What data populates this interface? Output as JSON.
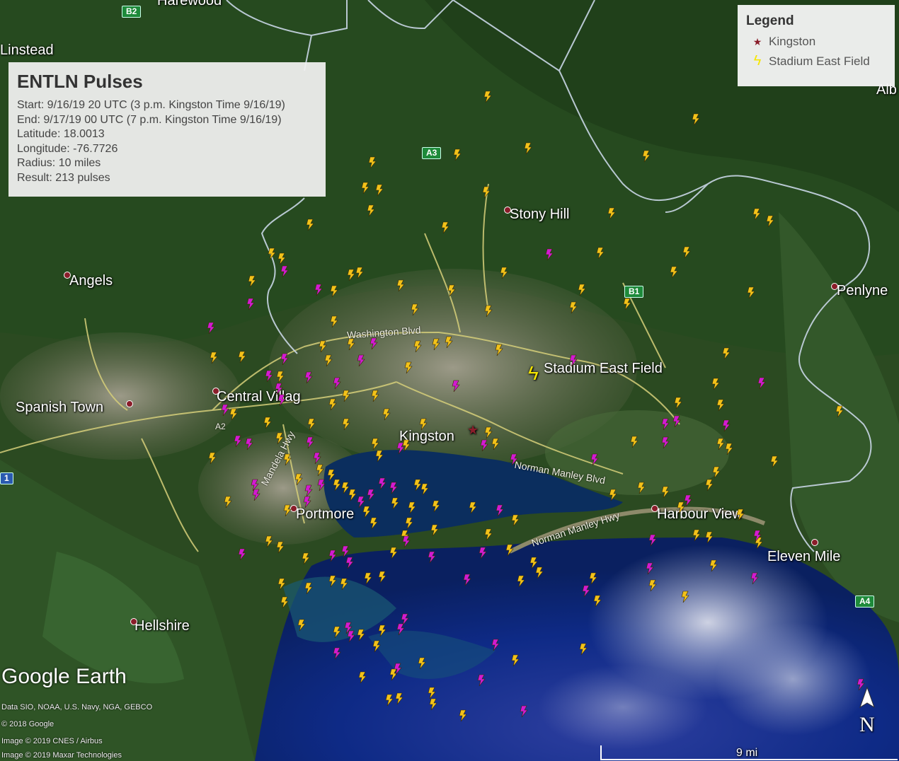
{
  "info_box": {
    "title": "ENTLN Pulses",
    "start": "Start: 9/16/19 20 UTC (3 p.m. Kingston Time 9/16/19)",
    "end": "End: 9/17/19 00 UTC (7 p.m. Kingston Time 9/16/19)",
    "latitude": "Latitude: 18.0013",
    "longitude": "Longitude: -76.7726",
    "radius": "Radius: 10 miles",
    "result": "Result: 213 pulses"
  },
  "legend": {
    "title": "Legend",
    "items": [
      {
        "label": "Kingston",
        "icon": "star-marker-icon",
        "color": "#8a1d2a"
      },
      {
        "label": "Stadium East Field",
        "icon": "lightning-cluster-icon",
        "color": "#f5e600"
      }
    ]
  },
  "places": {
    "harewood": "Harewood",
    "linstead": "Linstead",
    "angels": "Angels",
    "stony_hill": "Stony Hill",
    "penlyne": "Penlyne",
    "spanish_town": "Spanish Town",
    "central_village": "Central Villag",
    "kingston": "Kingston",
    "portmore": "Portmore",
    "harbour_view": "Harbour View",
    "eleven_mile": "Eleven Mile",
    "hellshire": "Hellshire",
    "stadium_east_field": "Stadium East Field",
    "alb": "Alb"
  },
  "roads": {
    "washington_blvd": "Washington Blvd",
    "norman_manley_blvd": "Norman Manley Blvd",
    "norman_manley_hwy": "Norman Manley Hwy",
    "nelson_mandela": "Mandela Hwy"
  },
  "shields": {
    "b2": "B2",
    "a3": "A3",
    "b1": "B1",
    "a4": "A4",
    "a1": "1",
    "a2": "A2"
  },
  "attribution": {
    "logo": "Google Earth",
    "line1": "Data SIO, NOAA, U.S. Navy, NGA, GEBCO",
    "line2": "© 2018 Google",
    "line3": "Image © 2019 CNES / Airbus",
    "line4": "Image © 2019 Maxar Technologies"
  },
  "scale_label": "9 mi",
  "north_label": "N",
  "colors": {
    "pulse_yellow": "#f2c21a",
    "pulse_magenta": "#d21ad2",
    "boundary": "#c9d6e6",
    "road": "#d9d37a",
    "water": "#0d2a7a"
  },
  "pulses": {
    "yellow": [
      [
        689,
        137
      ],
      [
        983,
        169
      ],
      [
        746,
        210
      ],
      [
        646,
        219
      ],
      [
        913,
        221
      ],
      [
        526,
        230
      ],
      [
        516,
        266
      ],
      [
        536,
        269
      ],
      [
        687,
        272
      ],
      [
        524,
        298
      ],
      [
        864,
        302
      ],
      [
        1069,
        303
      ],
      [
        1088,
        313
      ],
      [
        438,
        318
      ],
      [
        629,
        322
      ],
      [
        384,
        359
      ],
      [
        970,
        357
      ],
      [
        848,
        358
      ],
      [
        398,
        366
      ],
      [
        952,
        385
      ],
      [
        496,
        389
      ],
      [
        508,
        386
      ],
      [
        712,
        386
      ],
      [
        472,
        412
      ],
      [
        566,
        404
      ],
      [
        356,
        398
      ],
      [
        638,
        411
      ],
      [
        822,
        410
      ],
      [
        1061,
        414
      ],
      [
        586,
        438
      ],
      [
        690,
        440
      ],
      [
        810,
        435
      ],
      [
        886,
        430
      ],
      [
        472,
        455
      ],
      [
        302,
        506
      ],
      [
        456,
        490
      ],
      [
        496,
        487
      ],
      [
        590,
        490
      ],
      [
        616,
        487
      ],
      [
        634,
        484
      ],
      [
        705,
        495
      ],
      [
        342,
        505
      ],
      [
        464,
        510
      ],
      [
        577,
        520
      ],
      [
        1026,
        500
      ],
      [
        1011,
        543
      ],
      [
        958,
        570
      ],
      [
        1018,
        573
      ],
      [
        1186,
        582
      ],
      [
        489,
        560
      ],
      [
        530,
        560
      ],
      [
        546,
        586
      ],
      [
        489,
        600
      ],
      [
        396,
        533
      ],
      [
        470,
        572
      ],
      [
        330,
        586
      ],
      [
        378,
        598
      ],
      [
        440,
        600
      ],
      [
        395,
        620
      ],
      [
        300,
        648
      ],
      [
        406,
        650
      ],
      [
        422,
        678
      ],
      [
        488,
        690
      ],
      [
        530,
        628
      ],
      [
        536,
        645
      ],
      [
        574,
        630
      ],
      [
        598,
        600
      ],
      [
        690,
        612
      ],
      [
        700,
        628
      ],
      [
        896,
        625
      ],
      [
        1018,
        628
      ],
      [
        1030,
        635
      ],
      [
        1094,
        653
      ],
      [
        1012,
        668
      ],
      [
        1002,
        686
      ],
      [
        452,
        665
      ],
      [
        468,
        672
      ],
      [
        476,
        686
      ],
      [
        498,
        700
      ],
      [
        556,
        690
      ],
      [
        590,
        686
      ],
      [
        600,
        692
      ],
      [
        616,
        716
      ],
      [
        322,
        710
      ],
      [
        406,
        722
      ],
      [
        518,
        724
      ],
      [
        528,
        740
      ],
      [
        558,
        712
      ],
      [
        582,
        718
      ],
      [
        578,
        740
      ],
      [
        572,
        758
      ],
      [
        614,
        750
      ],
      [
        668,
        718
      ],
      [
        690,
        756
      ],
      [
        728,
        736
      ],
      [
        720,
        778
      ],
      [
        380,
        766
      ],
      [
        396,
        774
      ],
      [
        432,
        790
      ],
      [
        398,
        826
      ],
      [
        436,
        832
      ],
      [
        470,
        822
      ],
      [
        486,
        826
      ],
      [
        520,
        818
      ],
      [
        540,
        816
      ],
      [
        556,
        782
      ],
      [
        754,
        796
      ],
      [
        762,
        810
      ],
      [
        736,
        822
      ],
      [
        866,
        700
      ],
      [
        906,
        690
      ],
      [
        940,
        696
      ],
      [
        962,
        718
      ],
      [
        1046,
        728
      ],
      [
        1002,
        760
      ],
      [
        984,
        757
      ],
      [
        1008,
        800
      ],
      [
        1072,
        768
      ],
      [
        838,
        818
      ],
      [
        844,
        850
      ],
      [
        922,
        828
      ],
      [
        968,
        844
      ],
      [
        402,
        852
      ],
      [
        426,
        884
      ],
      [
        476,
        894
      ],
      [
        510,
        898
      ],
      [
        540,
        892
      ],
      [
        532,
        914
      ],
      [
        596,
        938
      ],
      [
        824,
        918
      ],
      [
        728,
        934
      ],
      [
        512,
        958
      ],
      [
        556,
        954
      ],
      [
        550,
        990
      ],
      [
        564,
        988
      ],
      [
        610,
        980
      ],
      [
        612,
        996
      ],
      [
        654,
        1012
      ]
    ],
    "magenta": [
      [
        776,
        360
      ],
      [
        402,
        384
      ],
      [
        450,
        410
      ],
      [
        354,
        430
      ],
      [
        298,
        464
      ],
      [
        528,
        486
      ],
      [
        510,
        510
      ],
      [
        402,
        508
      ],
      [
        380,
        532
      ],
      [
        436,
        534
      ],
      [
        644,
        546
      ],
      [
        476,
        542
      ],
      [
        394,
        550
      ],
      [
        398,
        566
      ],
      [
        318,
        580
      ],
      [
        810,
        510
      ],
      [
        1076,
        542
      ],
      [
        940,
        600
      ],
      [
        956,
        596
      ],
      [
        1026,
        602
      ],
      [
        940,
        626
      ],
      [
        336,
        624
      ],
      [
        352,
        628
      ],
      [
        438,
        626
      ],
      [
        448,
        648
      ],
      [
        566,
        634
      ],
      [
        684,
        630
      ],
      [
        726,
        650
      ],
      [
        840,
        650
      ],
      [
        360,
        686
      ],
      [
        362,
        700
      ],
      [
        436,
        694
      ],
      [
        434,
        710
      ],
      [
        454,
        686
      ],
      [
        510,
        710
      ],
      [
        524,
        700
      ],
      [
        540,
        684
      ],
      [
        556,
        690
      ],
      [
        706,
        722
      ],
      [
        972,
        708
      ],
      [
        574,
        766
      ],
      [
        610,
        788
      ],
      [
        660,
        820
      ],
      [
        682,
        782
      ],
      [
        488,
        780
      ],
      [
        494,
        796
      ],
      [
        470,
        786
      ],
      [
        342,
        784
      ],
      [
        922,
        764
      ],
      [
        918,
        804
      ],
      [
        828,
        836
      ],
      [
        1070,
        758
      ],
      [
        1066,
        818
      ],
      [
        572,
        876
      ],
      [
        566,
        890
      ],
      [
        492,
        888
      ],
      [
        496,
        900
      ],
      [
        476,
        924
      ],
      [
        700,
        912
      ],
      [
        562,
        946
      ],
      [
        680,
        962
      ],
      [
        740,
        1006
      ],
      [
        1216,
        968
      ]
    ]
  }
}
